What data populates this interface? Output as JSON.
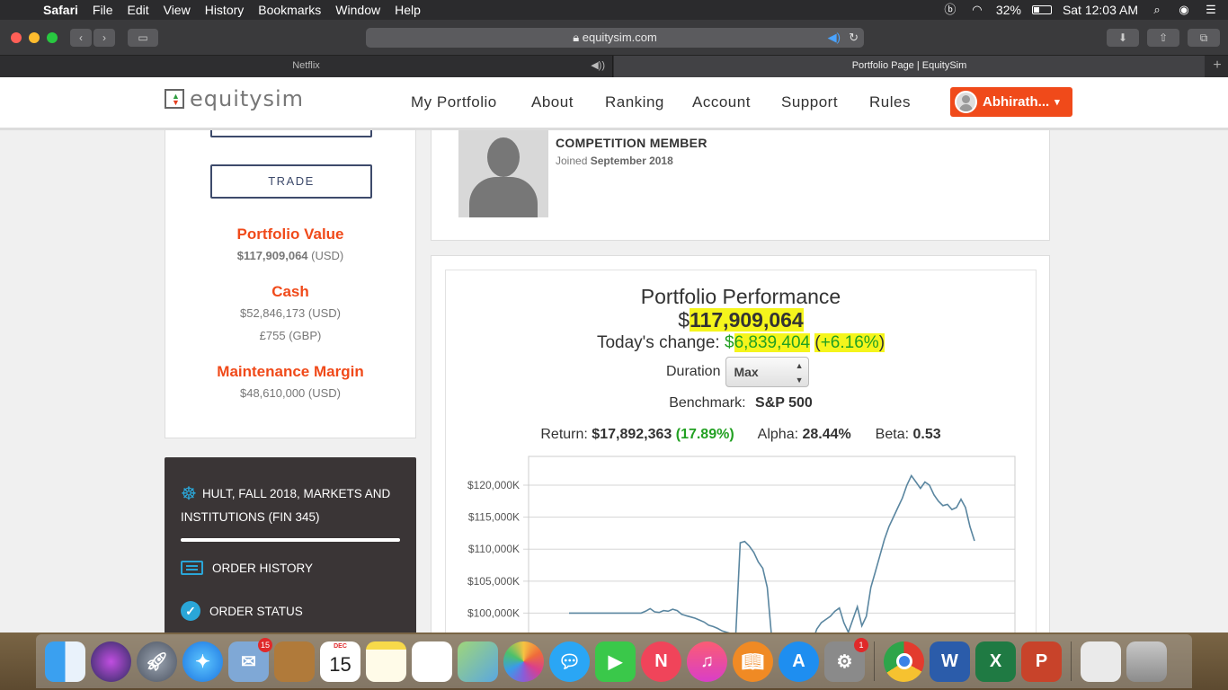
{
  "menubar": {
    "apple": "",
    "items": [
      "Safari",
      "File",
      "Edit",
      "View",
      "History",
      "Bookmarks",
      "Window",
      "Help"
    ],
    "battery_percent": "32%",
    "clock": "Sat 12:03 AM"
  },
  "browser": {
    "address": "equitysim.com",
    "tabs": [
      {
        "label": "Netflix",
        "active": false
      },
      {
        "label": "Portfolio Page | EquitySim",
        "active": true
      }
    ],
    "new_tab": "+"
  },
  "site": {
    "logo_text": "equitysim",
    "nav": [
      "My Portfolio",
      "About",
      "Ranking",
      "Account",
      "Support",
      "Rules"
    ],
    "user_name": "Abhirath...",
    "user_caret": "▾"
  },
  "left_panel": {
    "trade_label": "TRADE",
    "portfolio_value_label": "Portfolio Value",
    "portfolio_value_amount": "$117,909,064",
    "portfolio_value_currency": "(USD)",
    "cash_label": "Cash",
    "cash_usd_amount": "$52,846,173",
    "cash_usd_currency": "(USD)",
    "cash_gbp_amount": "£755",
    "cash_gbp_currency": "(GBP)",
    "margin_label": "Maintenance Margin",
    "margin_amount": "$48,610,000",
    "margin_currency": "(USD)"
  },
  "dark_panel": {
    "course": "HULT, FALL 2018, MARKETS AND INSTITUTIONS (FIN 345)",
    "links": [
      "ORDER HISTORY",
      "ORDER STATUS"
    ]
  },
  "profile": {
    "role": "COMPETITION MEMBER",
    "joined_prefix": "Joined",
    "joined_date": "September 2018"
  },
  "performance": {
    "title": "Portfolio Performance",
    "currency_symbol": "$",
    "value": "117,909,064",
    "change_label": "Today's change:",
    "change_symbol": "$",
    "change_amount": "6,839,404",
    "change_pct_open": "(",
    "change_pct": "+6.16%",
    "change_pct_close": ")",
    "duration_label": "Duration",
    "duration_value": "Max",
    "benchmark_label": "Benchmark:",
    "benchmark_value": "S&P 500",
    "return_label": "Return:",
    "return_amount": "$17,892,363",
    "return_pct": "(17.89%)",
    "alpha_label": "Alpha:",
    "alpha_value": "28.44%",
    "beta_label": "Beta:",
    "beta_value": "0.53"
  },
  "chart_data": {
    "type": "line",
    "title": "",
    "xlabel": "",
    "ylabel": "",
    "ylim": [
      95000,
      124500
    ],
    "y_ticks": [
      100000,
      105000,
      110000,
      115000,
      120000
    ],
    "y_tick_labels": [
      "$100,000K",
      "$105,000K",
      "$110,000K",
      "$115,000K",
      "$120,000K"
    ],
    "grid": true,
    "series": [
      {
        "color": "#5a86a0",
        "x": [
          0,
          1,
          2,
          3,
          4,
          5,
          6,
          7,
          8,
          9,
          10,
          11,
          12,
          13,
          14,
          15,
          16,
          17,
          18,
          19,
          20,
          21,
          22,
          23,
          24,
          25,
          26,
          27,
          28,
          29,
          30,
          31,
          32,
          33,
          34,
          35,
          36,
          37,
          38,
          39,
          40,
          41,
          42,
          43,
          44,
          45,
          46,
          47,
          48,
          49,
          50,
          51,
          52,
          53,
          54,
          55,
          56,
          57,
          58,
          59,
          60,
          61,
          62,
          63,
          64,
          65,
          66,
          67,
          68,
          69,
          70,
          71,
          72,
          73,
          74,
          75,
          76,
          77,
          78,
          79,
          80,
          81,
          82,
          83,
          84,
          85,
          86,
          87,
          88,
          89,
          90
        ],
        "values": [
          100000,
          100000,
          100000,
          100000,
          100000,
          100000,
          100000,
          100000,
          100000,
          100000,
          100000,
          100000,
          100000,
          100000,
          100000,
          100000,
          100000,
          100300,
          100700,
          100200,
          100100,
          100400,
          100300,
          100600,
          100400,
          99800,
          99600,
          99400,
          99200,
          98900,
          98600,
          98100,
          97900,
          97600,
          97200,
          97000,
          96800,
          96500,
          111000,
          111200,
          110500,
          109500,
          108000,
          107000,
          104000,
          96000,
          94500,
          94000,
          94200,
          94500,
          94300,
          93800,
          94100,
          94600,
          95500,
          97500,
          98500,
          99000,
          99500,
          100300,
          100800,
          98500,
          97000,
          99000,
          101000,
          98000,
          99500,
          104000,
          106500,
          109000,
          111500,
          113500,
          115000,
          116500,
          118000,
          120000,
          121500,
          120500,
          119500,
          120500,
          120000,
          118500,
          117500,
          116800,
          117000,
          116200,
          116500,
          117800,
          116500,
          113500,
          111300
        ]
      }
    ]
  },
  "dock": {
    "calendar_month": "DEC",
    "calendar_day": "15",
    "mail_badge": "15",
    "prefs_badge": "1"
  }
}
